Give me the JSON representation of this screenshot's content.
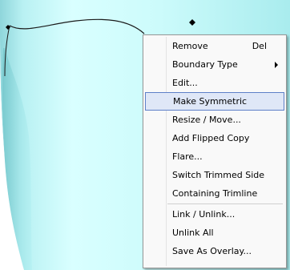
{
  "colors": {
    "shape_light": "#e6ffff",
    "shape_mid": "#b3f2f2",
    "shape_dark": "#7fcfd3",
    "outline": "#1a1a1a",
    "menu_highlight": "#dfe7f7",
    "menu_highlight_border": "#5e80c8"
  },
  "context_menu": {
    "items": [
      {
        "label": "Remove",
        "shortcut": "Del"
      },
      {
        "label": "Boundary Type",
        "submenu": true
      },
      {
        "label": "Edit..."
      },
      {
        "label": "Make Symmetric",
        "highlighted": true
      },
      {
        "label": "Resize / Move..."
      },
      {
        "label": "Add Flipped Copy"
      },
      {
        "label": "Flare..."
      },
      {
        "label": "Switch Trimmed Side"
      },
      {
        "label": "Containing Trimline"
      },
      {
        "label": "Link / Unlink..."
      },
      {
        "label": "Unlink All"
      },
      {
        "label": "Save As Overlay..."
      }
    ]
  }
}
